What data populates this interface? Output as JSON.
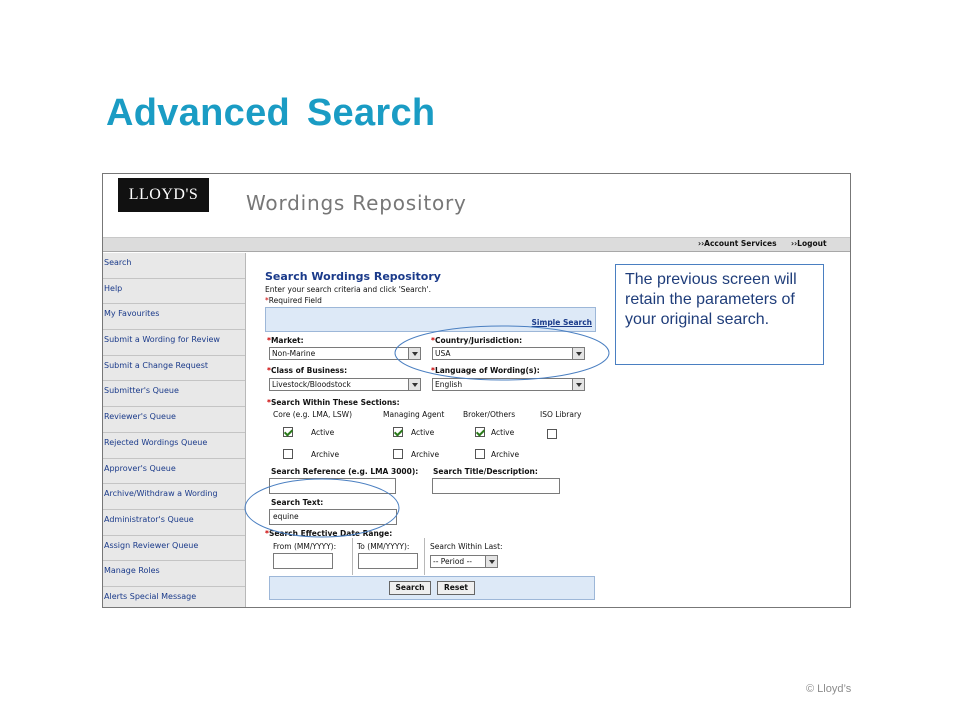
{
  "slide": {
    "title": "Advanced Search",
    "copyright": "© Lloyd’s",
    "callout": "The previous screen will retain the parameters of your original search.",
    "oval_color": "#4a7fc1",
    "title_color": "#1a9cc4"
  },
  "app": {
    "logo": "LLOYD'S",
    "title": "Wordings Repository",
    "topnav": [
      "››Account Services",
      "››Logout"
    ]
  },
  "sidebar": {
    "items": [
      "Search",
      "Help",
      "My Favourites",
      "Submit a Wording for Review",
      "Submit a Change Request",
      "Submitter's Queue",
      "Reviewer's Queue",
      "Rejected Wordings Queue",
      "Approver's Queue",
      "Archive/Withdraw a Wording",
      "Administrator's Queue",
      "Assign Reviewer Queue",
      "Manage Roles",
      "Alerts Special Message"
    ]
  },
  "form": {
    "heading": "Search Wordings Repository",
    "instructions": "Enter your search criteria and click 'Search'.",
    "required_note": "Required Field",
    "simple_search": "Simple Search",
    "market_label": "Market:",
    "market_value": "Non-Marine",
    "country_label": "Country/Jurisdiction:",
    "country_value": "USA",
    "class_label": "Class of Business:",
    "class_value": "Livestock/Bloodstock",
    "language_label": "Language of Wording(s):",
    "language_value": "English",
    "sections_label": "Search Within These Sections:",
    "sections": [
      {
        "name": "Core (e.g. LMA, LSW)",
        "active": "Active",
        "archive": "Archive"
      },
      {
        "name": "Managing Agent",
        "active": "Active",
        "archive": "Archive"
      },
      {
        "name": "Broker/Others",
        "active": "Active",
        "archive": "Archive"
      },
      {
        "name": "ISO Library"
      }
    ],
    "search_ref_label": "Search Reference (e.g. LMA 3000):",
    "search_title_label": "Search Title/Description:",
    "search_text_label": "Search Text:",
    "search_text_value": "equine",
    "date_range_label": "Search Effective Date Range:",
    "from_label": "From (MM/YYYY):",
    "to_label": "To (MM/YYYY):",
    "within_label": "Search Within Last:",
    "period_value": "-- Period --",
    "search_button": "Search",
    "reset_button": "Reset"
  }
}
